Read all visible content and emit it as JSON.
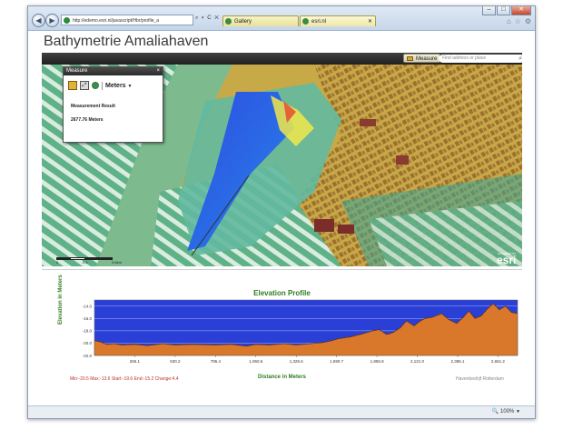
{
  "browser": {
    "address": "http://edemo.esri.nl/javascript/Hbr/profile_a",
    "addr_tools": "⌕ ▾ C ✕",
    "tabs": [
      {
        "label": "Gallery"
      },
      {
        "label": "esri.nl"
      }
    ],
    "window_buttons": [
      "–",
      "□",
      "✕"
    ],
    "right_tools": [
      "⌂",
      "☆",
      "⚙"
    ],
    "zoom": "100%"
  },
  "page": {
    "title": "Bathymetrie Amaliahaven"
  },
  "toolbar": {
    "measure_label": "Measure",
    "search_placeholder": "Find address or place"
  },
  "measure_panel": {
    "title": "Measure",
    "close": "×",
    "units": "Meters",
    "units_caret": "▼",
    "result_label": "Measurement Result",
    "result_value": "2677.76 Meters"
  },
  "map": {
    "scale_labels": [
      "0",
      "0.3",
      "0.6km"
    ],
    "logo": "esri",
    "logo_small": "POWERED BY"
  },
  "chart_data": {
    "type": "area",
    "title": "Elevation Profile",
    "xlabel": "Distance in Meters",
    "ylabel": "Elevation in Meters",
    "ylim": [
      -22.0,
      -13.0
    ],
    "xlim": [
      0,
      2780
    ],
    "y_ticks": [
      -14.0,
      -16.0,
      -18.0,
      -20.0,
      -22.0
    ],
    "y_tick_labels": [
      "-14.0",
      "-16.0",
      "-18.0",
      "-20.0",
      "-22.0"
    ],
    "x_ticks": [
      265.1,
      530.2,
      795.4,
      1060.5,
      1325.6,
      1590.7,
      1855.9,
      2121.0,
      2386.1,
      2651.2
    ],
    "x_tick_labels": [
      "265.1",
      "530.2",
      "795.4",
      "1,060.5",
      "1,325.6",
      "1,590.7",
      "1,855.9",
      "2,121.0",
      "2,386.1",
      "2,651.2"
    ],
    "x": [
      0,
      40,
      80,
      130,
      180,
      265,
      350,
      450,
      530,
      640,
      795,
      900,
      1000,
      1060,
      1150,
      1250,
      1325,
      1420,
      1500,
      1560,
      1600,
      1680,
      1760,
      1830,
      1870,
      1920,
      1960,
      2010,
      2050,
      2100,
      2130,
      2170,
      2220,
      2280,
      2330,
      2380,
      2420,
      2460,
      2500,
      2540,
      2580,
      2620,
      2660,
      2700,
      2740,
      2780
    ],
    "y": [
      -19.6,
      -19.8,
      -20.2,
      -20.1,
      -20.3,
      -20.2,
      -20.4,
      -20.1,
      -20.3,
      -20.2,
      -20.3,
      -20.2,
      -20.5,
      -20.2,
      -20.3,
      -20.1,
      -20.3,
      -20.1,
      -19.9,
      -19.6,
      -19.3,
      -19.0,
      -18.5,
      -18.0,
      -17.8,
      -18.6,
      -18.3,
      -17.5,
      -16.4,
      -17.2,
      -16.6,
      -16.0,
      -15.8,
      -15.2,
      -16.2,
      -16.8,
      -15.9,
      -14.8,
      -16.0,
      -15.6,
      -14.5,
      -13.6,
      -14.6,
      -14.0,
      -15.0,
      -15.2
    ],
    "stats": "Min:-20.5 Max:-13.6 Start:-19.6 End:-15.2 Change:4.4",
    "credit": "Havenbedrijf Rotterdam",
    "colors": {
      "water": "#2a3fd6",
      "ground": "#d9782a",
      "grid": "#ffffff"
    }
  }
}
